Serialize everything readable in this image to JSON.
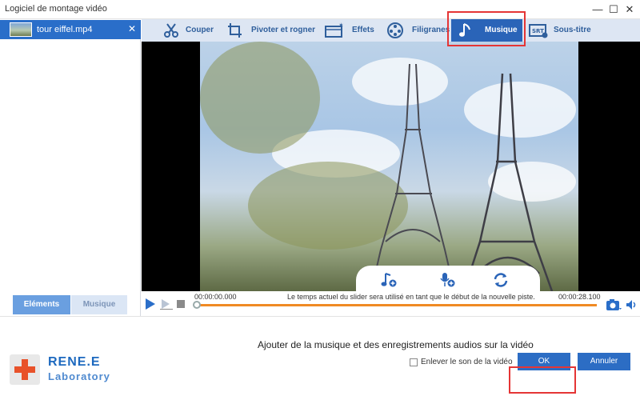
{
  "window": {
    "title": "Logiciel de montage vidéo",
    "minimize": "—",
    "maximize": "☐",
    "close": "✕"
  },
  "file": {
    "name": "tour eiffel.mp4",
    "close": "✕"
  },
  "left_tabs": {
    "elements": "Eléments",
    "music": "Musique"
  },
  "toolbar": {
    "items": [
      {
        "label": "Couper",
        "icon": "scissors-icon"
      },
      {
        "label": "Pivoter et rogner",
        "icon": "crop-rotate-icon"
      },
      {
        "label": "Effets",
        "icon": "effects-icon"
      },
      {
        "label": "Filigranes",
        "icon": "watermark-icon"
      },
      {
        "label": "Musique",
        "icon": "music-note-icon"
      },
      {
        "label": "Sous-titre",
        "icon": "subtitle-icon"
      }
    ],
    "active": "Musique"
  },
  "timeline": {
    "start": "00:00:00.000",
    "end": "00:00:28.100",
    "message": "Le temps actuel du slider sera utilisé en tant que le début de la nouvelle piste.",
    "progress": 0
  },
  "description": "Ajouter de la musique et des enregistrements audios sur la vidéo",
  "logo": {
    "line1": "RENE.E",
    "line2": "Laboratory"
  },
  "mute": {
    "label": "Enlever le son de la vidéo",
    "checked": false
  },
  "buttons": {
    "ok": "OK",
    "cancel": "Annuler"
  },
  "colors": {
    "accent": "#2c6dc4",
    "highlight": "#e53535",
    "progress": "#f08a24"
  }
}
